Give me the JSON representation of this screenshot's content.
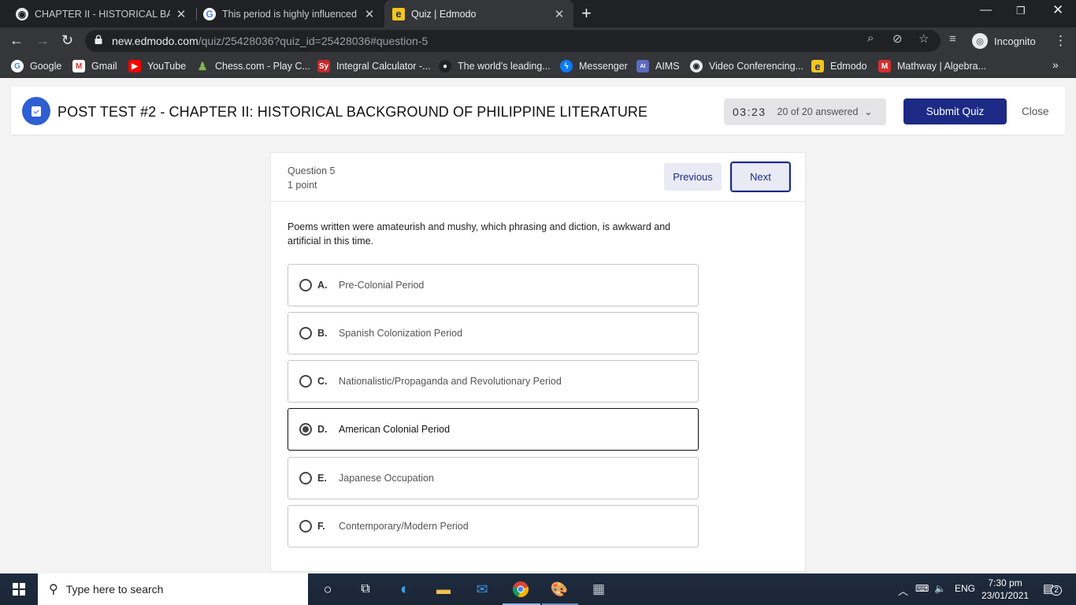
{
  "browser": {
    "tabs": [
      {
        "title": "CHAPTER II - HISTORICAL BACKG",
        "active": false
      },
      {
        "title": "This period is highly influenced b",
        "active": false
      },
      {
        "title": "Quiz | Edmodo",
        "active": true
      }
    ],
    "new_tab": "+",
    "url_host": "new.edmodo.com",
    "url_path": "/quiz/25428036?quiz_id=25428036#question-5",
    "profile_label": "Incognito",
    "bookmarks": [
      "Google",
      "Gmail",
      "YouTube",
      "Chess.com - Play C...",
      "Integral Calculator -...",
      "The world's leading...",
      "Messenger",
      "AIMS",
      "Video Conferencing...",
      "Edmodo",
      "Mathway | Algebra..."
    ]
  },
  "quiz": {
    "title": "POST TEST #2 - CHAPTER II: HISTORICAL BACKGROUND OF PHILIPPINE LITERATURE",
    "timer": "03:23",
    "answered": "20 of 20 answered",
    "submit_label": "Submit Quiz",
    "close_label": "Close"
  },
  "question": {
    "number_label": "Question 5",
    "points_label": "1 point",
    "prev_label": "Previous",
    "next_label": "Next",
    "text": "Poems written were amateurish and mushy, which phrasing and diction, is awkward and artificial in this time.",
    "options": [
      {
        "letter": "A.",
        "text": "Pre-Colonial Period",
        "selected": false
      },
      {
        "letter": "B.",
        "text": "Spanish Colonization Period",
        "selected": false
      },
      {
        "letter": "C.",
        "text": "Nationalistic/Propaganda and Revolutionary Period",
        "selected": false
      },
      {
        "letter": "D.",
        "text": "American Colonial Period",
        "selected": true
      },
      {
        "letter": "E.",
        "text": "Japanese Occupation",
        "selected": false
      },
      {
        "letter": "F.",
        "text": "Contemporary/Modern Period",
        "selected": false
      }
    ]
  },
  "taskbar": {
    "search_placeholder": "Type here to search",
    "language": "ENG",
    "time": "7:30 pm",
    "date": "23/01/2021",
    "notification_count": "2"
  },
  "colors": {
    "accent": "#1c2a85",
    "badge": "#2f5fd1",
    "chrome_dark": "#202124",
    "chrome_toolbar": "#35363a"
  }
}
